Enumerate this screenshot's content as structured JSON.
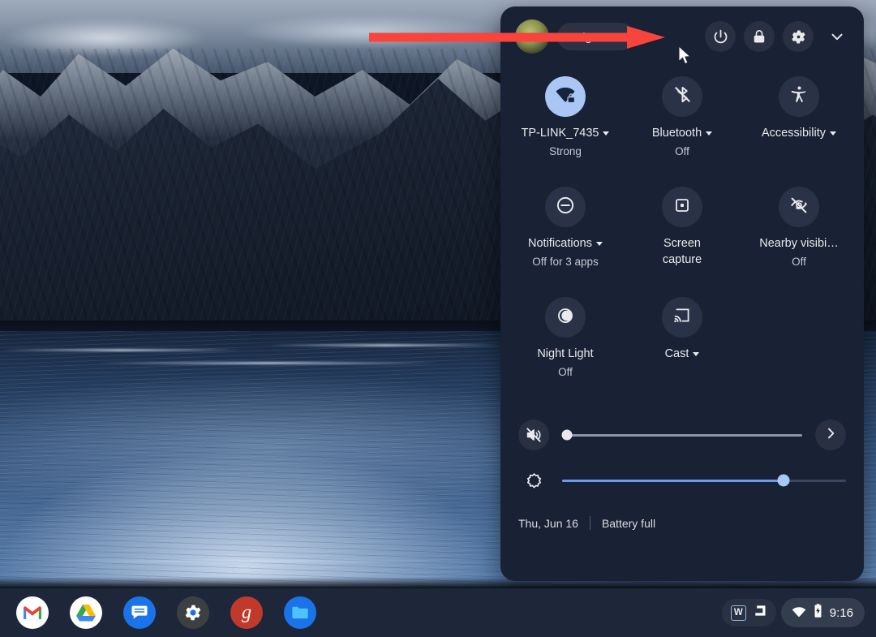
{
  "wallpaper": {
    "description": "dark mountain fjord at dusk with snowy peaks and lake"
  },
  "quick_settings": {
    "sign_out_label": "Sign out",
    "avatar_name": "user-avatar",
    "buttons": [
      {
        "name": "power-button",
        "icon": "power-icon",
        "label": "Power"
      },
      {
        "name": "lock-button",
        "icon": "lock-icon",
        "label": "Lock"
      },
      {
        "name": "settings-button",
        "icon": "gear-icon",
        "label": "Settings"
      },
      {
        "name": "collapse-button",
        "icon": "chevron-down-icon",
        "label": "Collapse"
      }
    ],
    "tiles": [
      {
        "name": "wifi-tile",
        "icon": "wifi-locked-icon",
        "label": "TP-LINK_7435",
        "sub": "Strong",
        "has_caret": true,
        "active": true
      },
      {
        "name": "bluetooth-tile",
        "icon": "bluetooth-disabled-icon",
        "label": "Bluetooth",
        "sub": "Off",
        "has_caret": true,
        "active": false
      },
      {
        "name": "accessibility-tile",
        "icon": "accessibility-icon",
        "label": "Accessibility",
        "sub": "",
        "has_caret": true,
        "active": false
      },
      {
        "name": "notifications-tile",
        "icon": "do-not-disturb-icon",
        "label": "Notifications",
        "sub": "Off for 3 apps",
        "has_caret": true,
        "active": false
      },
      {
        "name": "screen-capture-tile",
        "icon": "screen-capture-icon",
        "label": "Screen capture",
        "sub": "",
        "has_caret": false,
        "active": false
      },
      {
        "name": "nearby-visibility-tile",
        "icon": "eye-off-icon",
        "label": "Nearby visibi…",
        "sub": "Off",
        "has_caret": false,
        "active": false
      },
      {
        "name": "night-light-tile",
        "icon": "night-light-icon",
        "label": "Night Light",
        "sub": "Off",
        "has_caret": false,
        "active": false
      },
      {
        "name": "cast-tile",
        "icon": "cast-icon",
        "label": "Cast",
        "sub": "",
        "has_caret": true,
        "active": false
      }
    ],
    "sliders": {
      "volume": {
        "name": "volume-slider",
        "icon": "volume-muted-icon",
        "value": 2,
        "end_button_icon": "chevron-right-icon"
      },
      "brightness": {
        "name": "brightness-slider",
        "icon": "brightness-icon",
        "value": 78
      }
    },
    "footer": {
      "date": "Thu, Jun 16",
      "battery": "Battery full"
    }
  },
  "annotation": {
    "arrow_color": "#f8443c",
    "points_to": "power-button"
  },
  "shelf": {
    "apps": [
      {
        "name": "gmail-app-icon",
        "label": "Gmail"
      },
      {
        "name": "google-drive-app-icon",
        "label": "Google Drive"
      },
      {
        "name": "messages-app-icon",
        "label": "Messages"
      },
      {
        "name": "settings-app-icon",
        "label": "Settings"
      },
      {
        "name": "groovypost-app-icon",
        "label": "g"
      },
      {
        "name": "files-app-icon",
        "label": "Files"
      }
    ],
    "tray": {
      "ime_label": "W",
      "shelf_glyph": "shelf-icon",
      "wifi_icon": "wifi-icon",
      "battery_icon": "battery-charging-icon",
      "clock": "9:16"
    }
  },
  "colors": {
    "panel_bg": "#192134",
    "tile_inactive": "#2a3248",
    "tile_active": "#a9c6f5",
    "accent_blue": "#6d9aee",
    "shelf_bg": "#1d2739",
    "text_primary": "#e8eaed",
    "text_secondary": "#c3c9d4",
    "annotation_red": "#f8443c"
  }
}
